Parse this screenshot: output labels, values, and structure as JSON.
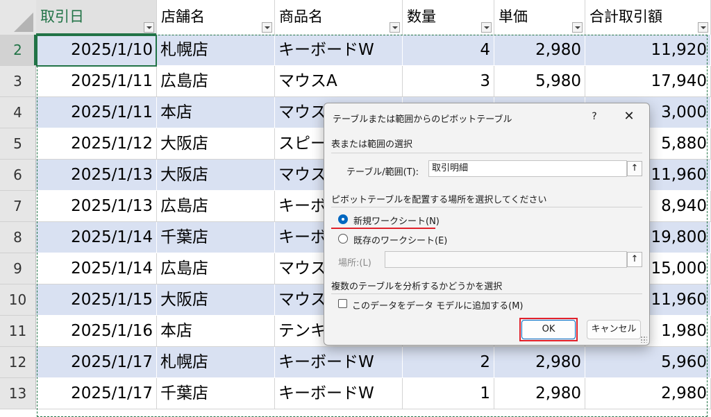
{
  "sheet": {
    "columns": [
      {
        "label": "取引日"
      },
      {
        "label": "店舗名"
      },
      {
        "label": "商品名"
      },
      {
        "label": "数量"
      },
      {
        "label": "単価"
      },
      {
        "label": "合計取引額"
      }
    ],
    "rows": [
      {
        "num": "2",
        "cells": [
          "2025/1/10",
          "札幌店",
          "キーボードW",
          "4",
          "2,980",
          "11,920"
        ]
      },
      {
        "num": "3",
        "cells": [
          "2025/1/11",
          "広島店",
          "マウスA",
          "3",
          "5,980",
          "17,940"
        ]
      },
      {
        "num": "4",
        "cells": [
          "2025/1/11",
          "本店",
          "マウス",
          "",
          "",
          "3,000"
        ]
      },
      {
        "num": "5",
        "cells": [
          "2025/1/12",
          "大阪店",
          "スピー",
          "",
          "",
          "5,880"
        ]
      },
      {
        "num": "6",
        "cells": [
          "2025/1/13",
          "大阪店",
          "マウス",
          "",
          "",
          "11,960"
        ]
      },
      {
        "num": "7",
        "cells": [
          "2025/1/13",
          "広島店",
          "キーボ",
          "",
          "",
          "8,940"
        ]
      },
      {
        "num": "8",
        "cells": [
          "2025/1/14",
          "千葉店",
          "キーボ",
          "",
          "",
          "19,800"
        ]
      },
      {
        "num": "9",
        "cells": [
          "2025/1/14",
          "広島店",
          "マウス",
          "",
          "",
          "15,000"
        ]
      },
      {
        "num": "10",
        "cells": [
          "2025/1/15",
          "大阪店",
          "マウス",
          "",
          "",
          "11,960"
        ]
      },
      {
        "num": "11",
        "cells": [
          "2025/1/16",
          "本店",
          "テンキ",
          "",
          "",
          "1,980"
        ]
      },
      {
        "num": "12",
        "cells": [
          "2025/1/17",
          "札幌店",
          "キーボードW",
          "2",
          "2,980",
          "5,960"
        ]
      },
      {
        "num": "13",
        "cells": [
          "2025/1/17",
          "千葉店",
          "キーボードW",
          "1",
          "2,980",
          "2,980"
        ]
      }
    ]
  },
  "dialog": {
    "title": "テーブルまたは範囲からのピボットテーブル",
    "help": "?",
    "close": "✕",
    "section1": "表または範囲の選択",
    "range_label": "テーブル/範囲(T):",
    "range_value": "取引明細",
    "section2": "ピボットテーブルを配置する場所を選択してください",
    "radio_new": "新規ワークシート(N)",
    "radio_existing": "既存のワークシート(E)",
    "location_label": "場所:(L)",
    "location_value": "",
    "section3": "複数のテーブルを分析するかどうかを選択",
    "datamodel_label": "このデータをデータ モデルに追加する(M)",
    "ok": "OK",
    "cancel": "キャンセル",
    "collapse_icon": "↑"
  },
  "colors": {
    "accent_green": "#217346",
    "band_blue": "#d9e1f2",
    "highlight_red": "#e0202a",
    "radio_blue": "#0067c0"
  }
}
